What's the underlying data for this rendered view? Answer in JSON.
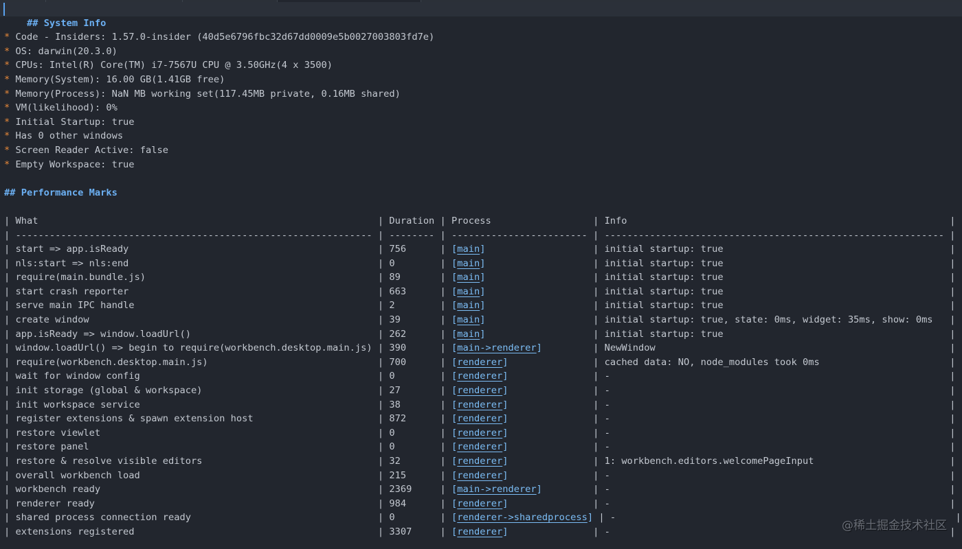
{
  "system_info": {
    "heading": "## System Info",
    "bullet_marker": "*",
    "items": [
      "Code - Insiders: 1.57.0-insider (40d5e6796fbc32d67dd0009e5b0027003803fd7e)",
      "OS: darwin(20.3.0)",
      "CPUs: Intel(R) Core(TM) i7-7567U CPU @ 3.50GHz(4 x 3500)",
      "Memory(System): 16.00 GB(1.41GB free)",
      "Memory(Process): NaN MB working set(117.45MB private, 0.16MB shared)",
      "VM(likelihood): 0%",
      "Initial Startup: true",
      "Has 0 other windows",
      "Screen Reader Active: false",
      "Empty Workspace: true"
    ]
  },
  "performance_marks": {
    "heading": "## Performance Marks",
    "columns": [
      "What",
      "Duration",
      "Process",
      "Info"
    ],
    "column_widths_chars": [
      63,
      8,
      24,
      60
    ],
    "rows": [
      {
        "what": "start => app.isReady",
        "duration": "756",
        "process": "main",
        "info": "initial startup: true"
      },
      {
        "what": "nls:start => nls:end",
        "duration": "0",
        "process": "main",
        "info": "initial startup: true"
      },
      {
        "what": "require(main.bundle.js)",
        "duration": "89",
        "process": "main",
        "info": "initial startup: true"
      },
      {
        "what": "start crash reporter",
        "duration": "663",
        "process": "main",
        "info": "initial startup: true"
      },
      {
        "what": "serve main IPC handle",
        "duration": "2",
        "process": "main",
        "info": "initial startup: true"
      },
      {
        "what": "create window",
        "duration": "39",
        "process": "main",
        "info": "initial startup: true, state: 0ms, widget: 35ms, show: 0ms"
      },
      {
        "what": "app.isReady => window.loadUrl()",
        "duration": "262",
        "process": "main",
        "info": "initial startup: true"
      },
      {
        "what": "window.loadUrl() => begin to require(workbench.desktop.main.js)",
        "duration": "390",
        "process": "main->renderer",
        "info": "NewWindow"
      },
      {
        "what": "require(workbench.desktop.main.js)",
        "duration": "700",
        "process": "renderer",
        "info": "cached data: NO, node_modules took 0ms"
      },
      {
        "what": "wait for window config",
        "duration": "0",
        "process": "renderer",
        "info": "-"
      },
      {
        "what": "init storage (global & workspace)",
        "duration": "27",
        "process": "renderer",
        "info": "-"
      },
      {
        "what": "init workspace service",
        "duration": "38",
        "process": "renderer",
        "info": "-"
      },
      {
        "what": "register extensions & spawn extension host",
        "duration": "872",
        "process": "renderer",
        "info": "-"
      },
      {
        "what": "restore viewlet",
        "duration": "0",
        "process": "renderer",
        "info": "-"
      },
      {
        "what": "restore panel",
        "duration": "0",
        "process": "renderer",
        "info": "-"
      },
      {
        "what": "restore & resolve visible editors",
        "duration": "32",
        "process": "renderer",
        "info": "1: workbench.editors.welcomePageInput"
      },
      {
        "what": "overall workbench load",
        "duration": "215",
        "process": "renderer",
        "info": "-"
      },
      {
        "what": "workbench ready",
        "duration": "2369",
        "process": "main->renderer",
        "info": "-"
      },
      {
        "what": "renderer ready",
        "duration": "984",
        "process": "renderer",
        "info": "-"
      },
      {
        "what": "shared process connection ready",
        "duration": "0",
        "process": "renderer->sharedprocess",
        "info": "-"
      },
      {
        "what": "extensions registered",
        "duration": "3307",
        "process": "renderer",
        "info": "-"
      }
    ]
  },
  "watermark": "@稀土掘金技术社区",
  "colors": {
    "background": "#22262e",
    "heading": "#6cb0f3",
    "bullet": "#e8893a",
    "link": "#7cbdf5",
    "text": "#c3c8d0"
  }
}
